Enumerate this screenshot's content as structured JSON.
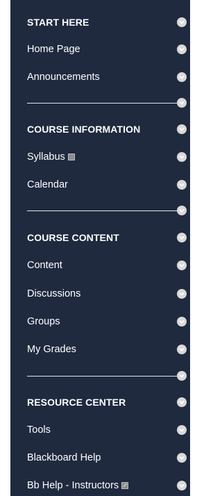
{
  "menu": {
    "sections": [
      {
        "header": "START HERE",
        "items": [
          "Home Page",
          "Announcements"
        ]
      },
      {
        "header": "COURSE INFORMATION",
        "items": [
          "Syllabus",
          "Calendar"
        ]
      },
      {
        "header": "COURSE CONTENT",
        "items": [
          "Content",
          "Discussions",
          "Groups",
          "My Grades"
        ]
      },
      {
        "header": "RESOURCE CENTER",
        "items": [
          "Tools",
          "Blackboard Help",
          "Bb Help - Instructors"
        ]
      }
    ]
  },
  "icons": {
    "menu_chevron": "chevron-down-icon",
    "file_attachment": "file-icon",
    "external_link": "external-link-icon"
  },
  "colors": {
    "menu_background": "#1f2a3f",
    "text": "#ffffff",
    "chevron": "#d9d9d9",
    "divider": "#e6e6e6"
  }
}
